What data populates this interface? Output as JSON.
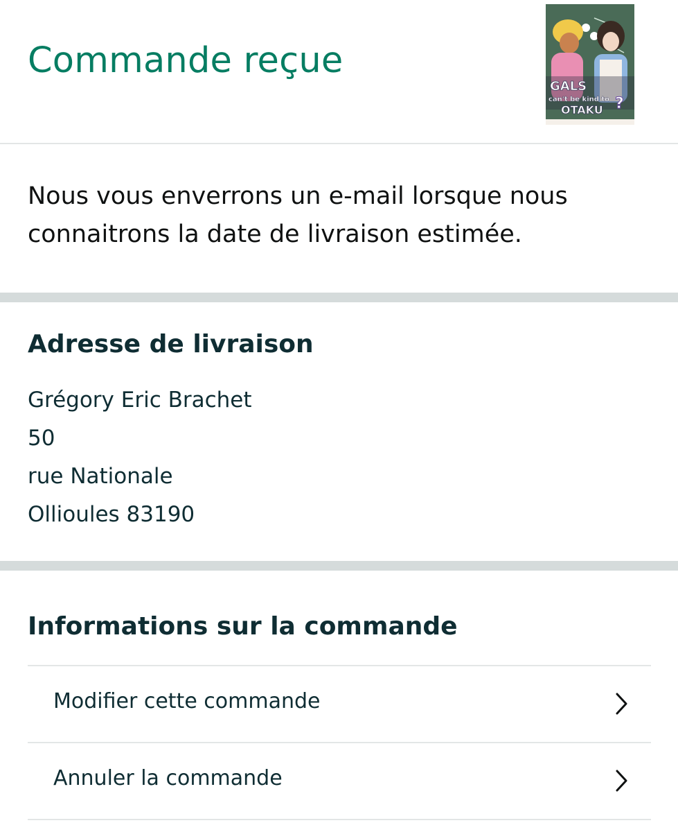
{
  "header": {
    "status_title": "Commande reçue",
    "product_thumbnail": {
      "icon": "product-cover-image",
      "cover_title_line1": "GALS",
      "cover_title_line2": "can't be kind to",
      "cover_title_line3": "OTAKU"
    }
  },
  "info": {
    "message": "Nous vous enverrons un e-mail lorsque nous connaitrons la date de livraison estimée."
  },
  "address": {
    "heading": "Adresse de livraison",
    "lines": [
      "Grégory Eric Brachet",
      "50",
      "rue Nationale",
      "Ollioules 83190"
    ]
  },
  "order_info": {
    "heading": "Informations sur la commande",
    "items": [
      {
        "label": "Modifier cette commande",
        "icon": "chevron-right-icon"
      },
      {
        "label": "Annuler la commande",
        "icon": "chevron-right-icon"
      }
    ]
  },
  "colors": {
    "status_green": "#067d62",
    "text_dark": "#0f2d33",
    "divider": "#d5dbdb",
    "border": "#e3e6e6"
  }
}
